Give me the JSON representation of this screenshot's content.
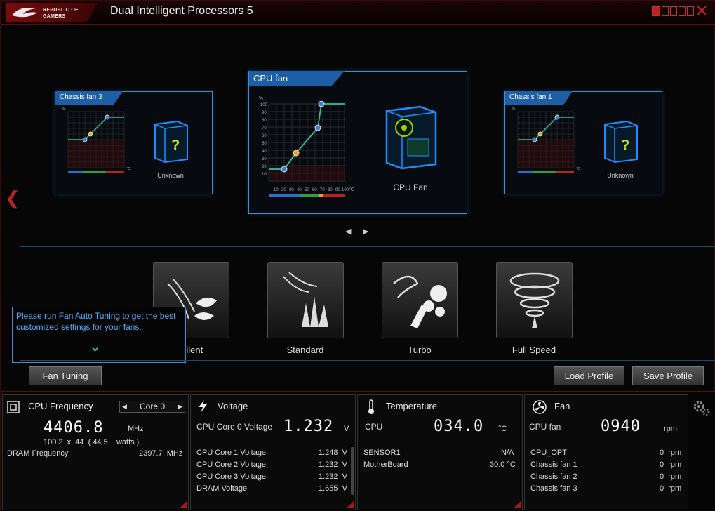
{
  "title": {
    "logo_line1": "REPUBLIC OF",
    "logo_line2": "GAMERS",
    "app_name": "Dual Intelligent Processors 5"
  },
  "fans": {
    "left": {
      "header": "Chassis fan 3",
      "case_label": "Unknown"
    },
    "center": {
      "header": "CPU fan",
      "case_label": "CPU Fan"
    },
    "right": {
      "header": "Chassis fan 1",
      "case_label": "Unknown"
    },
    "y_unit": "%",
    "x_unit": "°C",
    "y_ticks": [
      "100",
      "90",
      "80",
      "70",
      "60",
      "50",
      "40",
      "30",
      "20",
      "10"
    ],
    "x_ticks": [
      "10",
      "20",
      "30",
      "40",
      "50",
      "60",
      "70",
      "80",
      "90",
      "100"
    ]
  },
  "nav": {
    "prev": "◀",
    "next": "▶"
  },
  "modes": [
    {
      "label": "Silent"
    },
    {
      "label": "Standard"
    },
    {
      "label": "Turbo"
    },
    {
      "label": "Full Speed"
    }
  ],
  "tooltip": {
    "text": "Please run Fan Auto Tuning to get the best customized settings for your fans."
  },
  "buttons": {
    "fan_tuning": "Fan Tuning",
    "load_profile": "Load Profile",
    "save_profile": "Save Profile"
  },
  "cpu_freq": {
    "title": "CPU Frequency",
    "core_select": "Core 0",
    "value": "4406.8",
    "unit": "MHz",
    "detail": "100.2  x  44  ( 44.5    watts )",
    "dram_label": "DRAM Frequency",
    "dram_value": "2397.7  MHz"
  },
  "voltage": {
    "title": "Voltage",
    "main_label": "CPU Core 0 Voltage",
    "main_value": "1.232",
    "main_unit": "V",
    "rows": [
      {
        "label": "CPU Core 1 Voltage",
        "value": "1.248  V"
      },
      {
        "label": "CPU Core 2 Voltage",
        "value": "1.232  V"
      },
      {
        "label": "CPU Core 3 Voltage",
        "value": "1.232  V"
      },
      {
        "label": "DRAM Voltage",
        "value": "1.655  V"
      }
    ]
  },
  "temperature": {
    "title": "Temperature",
    "main_label": "CPU",
    "main_value": "034.0",
    "main_unit": "°C",
    "rows": [
      {
        "label": "SENSOR1",
        "value": "N/A"
      },
      {
        "label": "MotherBoard",
        "value": "30.0 °C"
      }
    ]
  },
  "fan_panel": {
    "title": "Fan",
    "main_label": "CPU fan",
    "main_value": "0940",
    "main_unit": "rpm",
    "rows": [
      {
        "label": "CPU_OPT",
        "value": "0  rpm"
      },
      {
        "label": "Chassis fan 1",
        "value": "0  rpm"
      },
      {
        "label": "Chassis fan 2",
        "value": "0  rpm"
      },
      {
        "label": "Chassis fan 3",
        "value": "0  rpm"
      }
    ]
  },
  "colors": {
    "accent_red": "#b22222",
    "accent_blue": "#3f8fd0",
    "curve": "#2ec4a0"
  }
}
